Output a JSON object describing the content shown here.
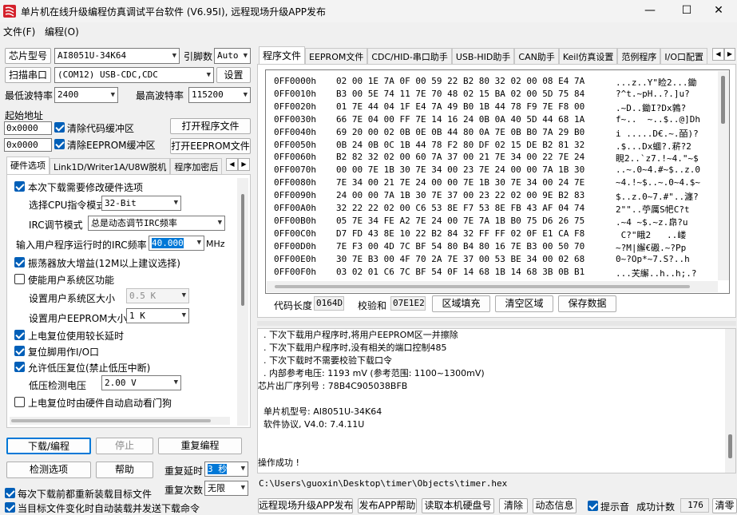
{
  "window": {
    "title": "单片机在线升级编程仿真调试平台软件 (V6.95I), 远程现场升级APP发布",
    "min": "—",
    "max": "☐",
    "close": "✕"
  },
  "menu": [
    "文件(F)",
    "编程(O)"
  ],
  "left": {
    "chip_label": "芯片型号",
    "chip_value": "AI8051U-34K64",
    "pin_label": "引脚数",
    "pin_value": "Auto",
    "scan_btn": "扫描串口",
    "port_value": "(COM12) USB-CDC,CDC",
    "settings_btn": "设置",
    "min_baud_label": "最低波特率",
    "min_baud_value": "2400",
    "max_baud_label": "最高波特率",
    "max_baud_value": "115200",
    "start_addr_label": "起始地址",
    "addr1": "0x0000",
    "clear_code_label": "清除代码缓冲区",
    "open_prog_btn": "打开程序文件",
    "addr2": "0x0000",
    "clear_eeprom_label": "清除EEPROM缓冲区",
    "open_eeprom_btn": "打开EEPROM文件",
    "tabs": [
      "硬件选项",
      "Link1D/Writer1A/U8W脱机",
      "程序加密后"
    ],
    "hw": {
      "opt_modify": "本次下载需要修改硬件选项",
      "cpu_label": "选择CPU指令模式",
      "cpu_value": "32-Bit",
      "irc_label": "IRC调节模式",
      "irc_value": "总是动态调节IRC频率",
      "freq_label": "输入用户程序运行时的IRC频率",
      "freq_value": "40.000",
      "freq_unit": "MHz",
      "osc_gain": "振荡器放大增益(12M以上建议选择)",
      "sys_area": "使能用户系统区功能",
      "sys_size_label": "设置用户系统区大小",
      "sys_size_value": "0.5 K",
      "eeprom_size_label": "设置用户EEPROM大小",
      "eeprom_size_value": "1   K",
      "long_reset": "上电复位使用较长延时",
      "reset_io": "复位脚用作I/O口",
      "lvr": "允许低压复位(禁止低压中断)",
      "lvd_label": "低压检测电压",
      "lvd_value": "2.00 V",
      "wdt": "上电复位时由硬件自动启动看门狗"
    },
    "download_btn": "下载/编程",
    "stop_btn": "停止",
    "reprogram_btn": "重复编程",
    "detect_btn": "检测选项",
    "help_btn": "帮助",
    "delay_label": "重复延时",
    "delay_value": "3 秒",
    "count_label": "重复次数",
    "count_value": "无限",
    "reload_label": "每次下载前都重新装载目标文件",
    "auto_label": "当目标文件变化时自动装载并发送下载命令"
  },
  "right": {
    "tabs": [
      "程序文件",
      "EEPROM文件",
      "CDC/HID-串口助手",
      "USB-HID助手",
      "CAN助手",
      "Keil仿真设置",
      "范例程序",
      "I/O口配置"
    ],
    "hex_rows": [
      {
        "addr": "0FF0000h",
        "bytes": "02 00 1E 7A 0F 00 59 22 B2 80 32 02 00 08 E4 7A",
        "ascii": "...z..Y\"睑2...鋤"
      },
      {
        "addr": "0FF0010h",
        "bytes": "B3 00 5E 74 11 7E 70 48 02 15 BA 02 00 5D 75 84",
        "ascii": "?^t.~pH..?.]u?"
      },
      {
        "addr": "0FF0020h",
        "bytes": "01 7E 44 04 1F E4 7A 49 B0 1B 44 78 F9 7E F8 00",
        "ascii": ".~D..鋤I?Dx鶉?"
      },
      {
        "addr": "0FF0030h",
        "bytes": "66 7E 04 00 FF 7E 14 16 24 0B 0A 40 5D 44 68 1A",
        "ascii": "f~..  ~..$..@]Dh"
      },
      {
        "addr": "0FF0040h",
        "bytes": "69 20 00 02 0B 0E 0B 44 80 0A 7E 0B B0 7A 29 B0",
        "ascii": "i .....D€.~.皕)?"
      },
      {
        "addr": "0FF0050h",
        "bytes": "0B 24 0B 0C 1B 44 78 F2 80 DF 02 15 DE B2 81 32",
        "ascii": ".$...Dx蜖?.菥?2"
      },
      {
        "addr": "0FF0060h",
        "bytes": "B2 82 32 02 00 60 7A 37 00 21 7E 34 00 22 7E 24",
        "ascii": "睍2..`z7.!~4.\"~$"
      },
      {
        "addr": "0FF0070h",
        "bytes": "00 00 7E 1B 30 7E 34 00 23 7E 24 00 00 7A 1B 30",
        "ascii": "..~.0~4.#~$..z.0"
      },
      {
        "addr": "0FF0080h",
        "bytes": "7E 34 00 21 7E 24 00 00 7E 1B 30 7E 34 00 24 7E",
        "ascii": "~4.!~$..~.0~4.$~"
      },
      {
        "addr": "0FF0090h",
        "bytes": "24 00 00 7A 1B 30 7E 37 00 23 22 02 00 9E B2 83",
        "ascii": "$..z.0~7.#\"..瀍?"
      },
      {
        "addr": "0FF00A0h",
        "bytes": "32 22 22 02 00 C6 53 8E F7 53 8E FB 43 AF 04 74",
        "ascii": "2\"\"..苧厲S帊C?t"
      },
      {
        "addr": "0FF00B0h",
        "bytes": "05 7E 34 FE A2 7E 24 00 7E 7A 1B B0 75 D6 26 75",
        "ascii": ".~4 ~$.~z.皍?u"
      },
      {
        "addr": "0FF00C0h",
        "bytes": "D7 FD 43 8E 10 22 B2 84 32 FF FF 02 0F E1 CA F8",
        "ascii": " C?\"睋2   ..嵝"
      },
      {
        "addr": "0FF00D0h",
        "bytes": "7E F3 00 4D 7C BF 54 80 B4 80 16 7E B3 00 50 70",
        "ascii": "~?M|繲€磤.~?Pp"
      },
      {
        "addr": "0FF00E0h",
        "bytes": "30 7E B3 00 4F 70 2A 7E 37 00 53 BE 34 00 02 68",
        "ascii": "0~?Op*~7.S?..h"
      },
      {
        "addr": "0FF00F0h",
        "bytes": "03 02 01 C6 7C BF 54 0F 14 68 1B 14 68 3B 0B B1",
        "ascii": "...芖繲..h..h;.?"
      }
    ],
    "code_len_label": "代码长度",
    "code_len_value": "0164D",
    "checksum_label": "校验和",
    "checksum_value": "07E1E2",
    "fill_btn": "区域填充",
    "clear_btn": "清空区域",
    "save_btn": "保存数据",
    "log_lines": [
      "  . 下次下载用户程序时,将用户EEPROM区一并擦除",
      "  . 下次下载用户程序时,没有相关的端口控制485",
      "  . 下次下载时不需要校验下载口令",
      "  . 内部参考电压: 1193 mV (参考范围: 1100~1300mV)",
      "芯片出厂序列号 : 78B4C905038BFB",
      "",
      "  单片机型号: AI8051U-34K64",
      "  软件协议, V4.0: 7.4.11U",
      "",
      "",
      "操作成功 !"
    ],
    "file_path": "C:\\Users\\guoxin\\Desktop\\timer\\Objects\\timer.hex",
    "publish_btn": "远程现场升级APP发布",
    "publish_help_btn": "发布APP帮助",
    "disk_btn": "读取本机硬盘号",
    "clear_log_btn": "清除",
    "anim_btn": "动态信息",
    "beep_label": "提示音",
    "success_label": "成功计数",
    "success_value": "176",
    "clear2_btn": "清零"
  }
}
